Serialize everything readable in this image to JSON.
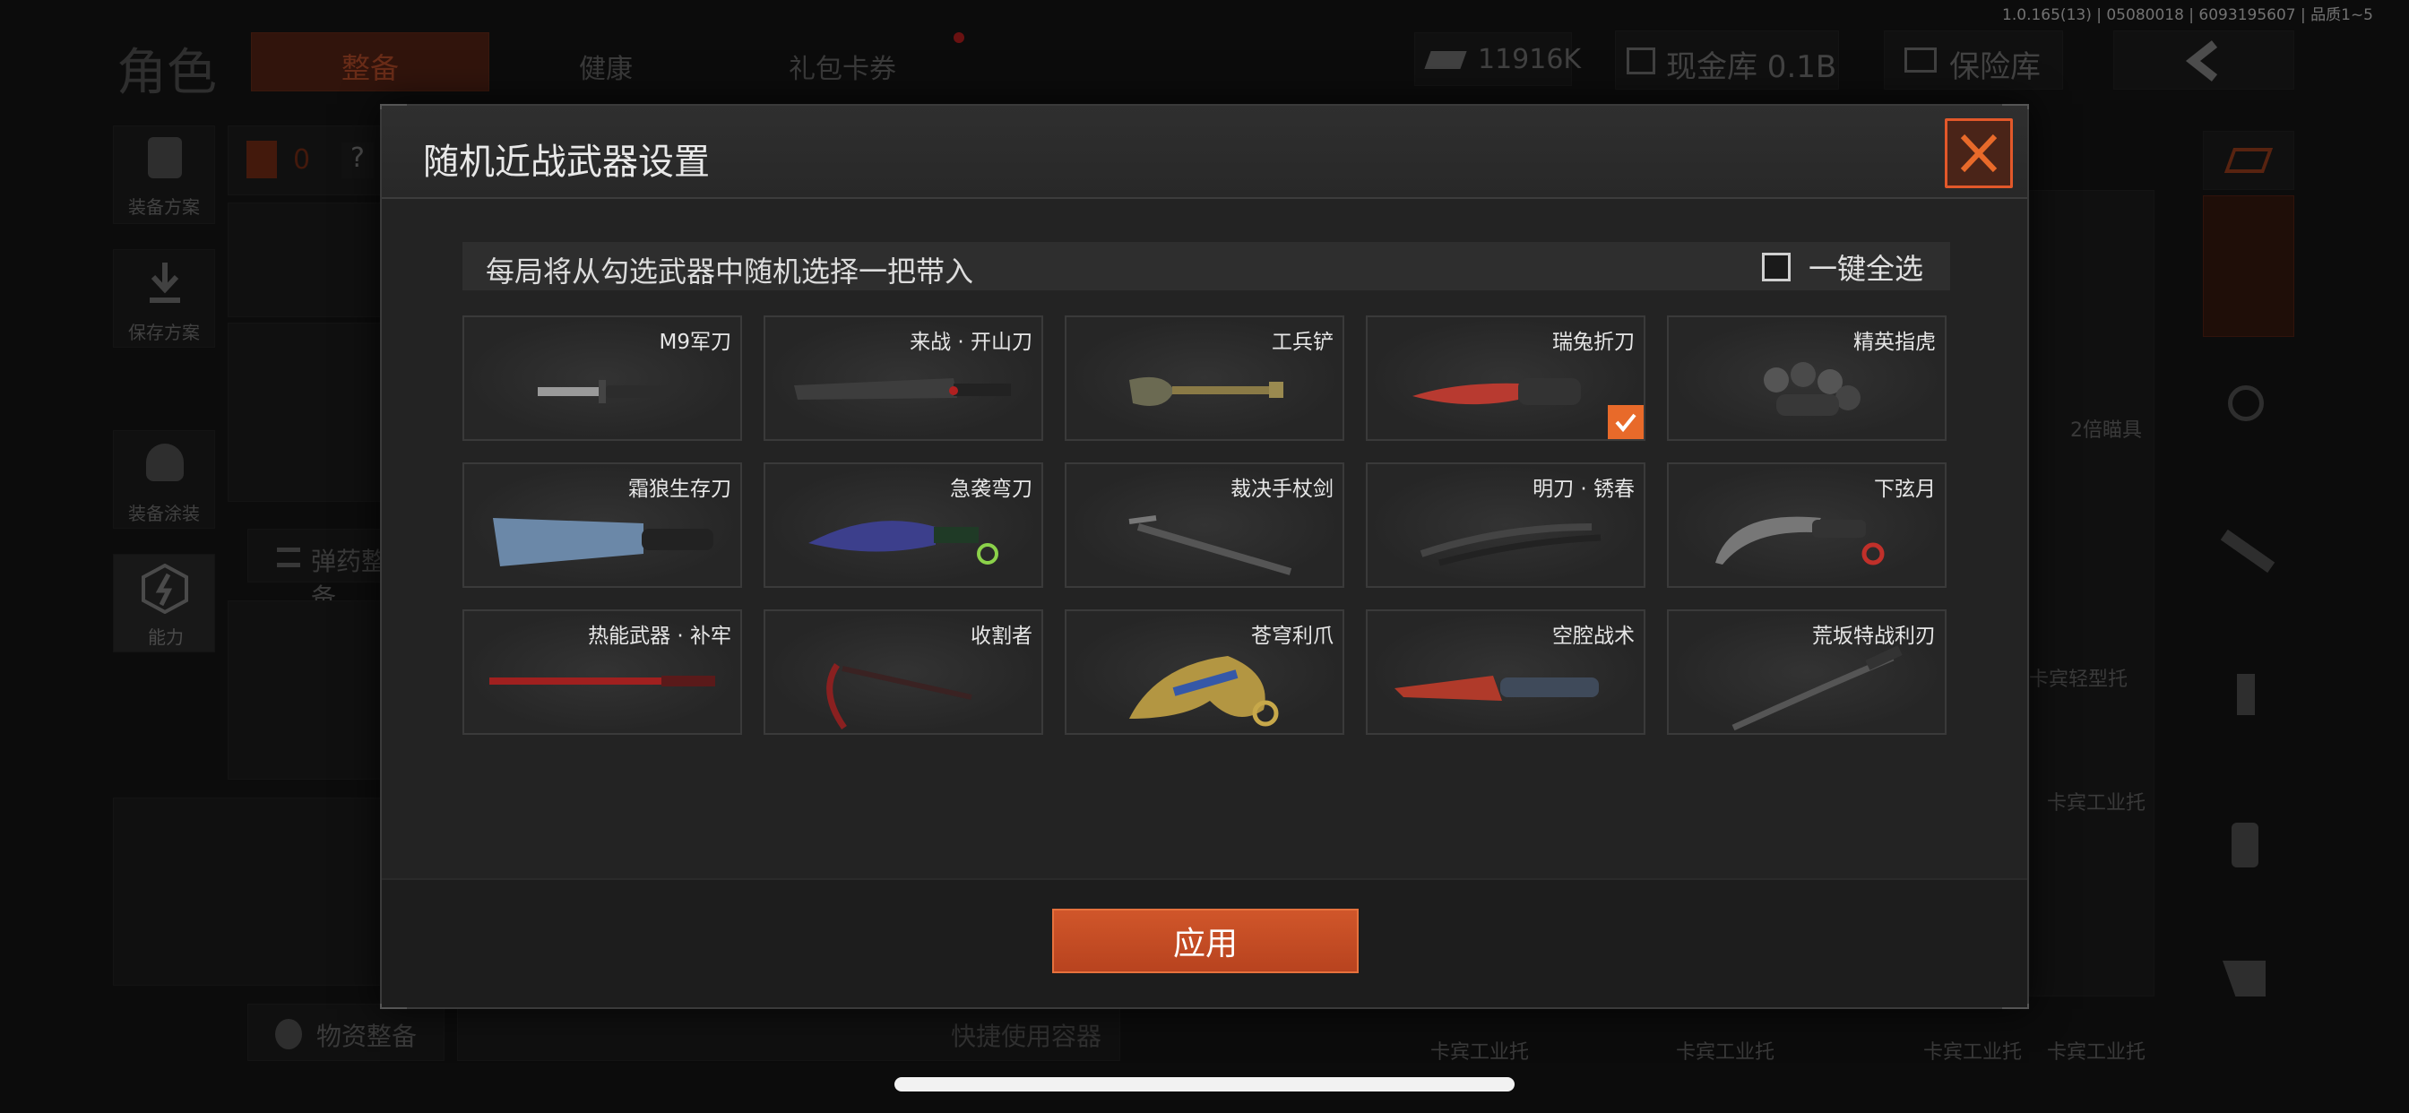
{
  "status": {
    "version": "1.0.165(13) | 05080018 | 6093195607 | 品质1~5"
  },
  "topbar": {
    "title": "角色",
    "tabs": [
      "整备",
      "健康",
      "礼包卡券"
    ],
    "currency": "11916K",
    "cash_vault": "现金库 0.1B",
    "safe_vault": "保险库"
  },
  "sidebar": {
    "items": [
      "装备方案",
      "保存方案",
      "装备涂装",
      "能力"
    ],
    "count": "0",
    "ammo_label": "弹药整备",
    "supply_label": "物资整备",
    "quick_container": "快捷使用容器"
  },
  "right_panel": {
    "labels": [
      "2倍瞄具",
      "卡宾轻型托",
      "卡宾工业托",
      "卡宾工业托",
      "卡宾工业托",
      "卡宾工业托",
      "卡宾工业托"
    ]
  },
  "modal": {
    "title": "随机近战武器设置",
    "hint": "每局将从勾选武器中随机选择一把带入",
    "select_all": "一键全选",
    "apply": "应用",
    "weapons": [
      {
        "name": "M9军刀",
        "checked": false
      },
      {
        "name": "来战 · 开山刀",
        "checked": false
      },
      {
        "name": "工兵铲",
        "checked": false
      },
      {
        "name": "瑞兔折刀",
        "checked": true
      },
      {
        "name": "精英指虎",
        "checked": false
      },
      {
        "name": "霜狼生存刀",
        "checked": false
      },
      {
        "name": "急袭弯刀",
        "checked": false
      },
      {
        "name": "裁决手杖剑",
        "checked": false
      },
      {
        "name": "明刀 · 锈春",
        "checked": false
      },
      {
        "name": "下弦月",
        "checked": false
      },
      {
        "name": "热能武器 · 补牢",
        "checked": false
      },
      {
        "name": "收割者",
        "checked": false
      },
      {
        "name": "苍穹利爪",
        "checked": false
      },
      {
        "name": "空腔战术",
        "checked": false
      },
      {
        "name": "荒坂特战利刃",
        "checked": false
      }
    ]
  },
  "colors": {
    "accent": "#e86a2a",
    "apply_button": "#c24d25",
    "panel": "#232323"
  }
}
